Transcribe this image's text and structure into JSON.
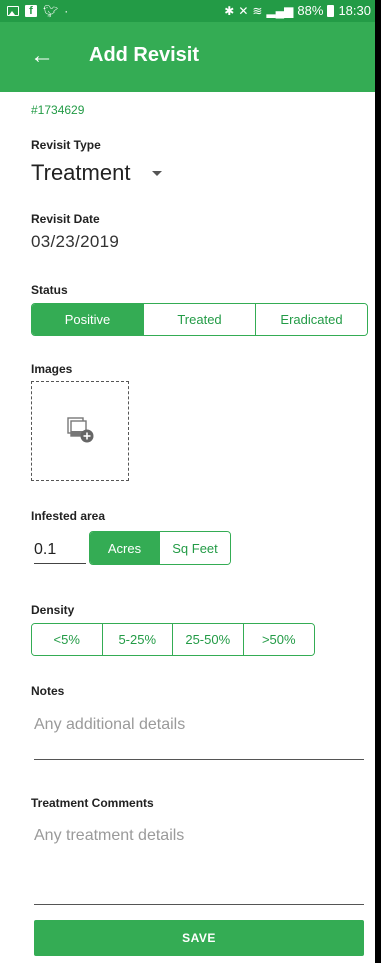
{
  "status_bar": {
    "battery": "88%",
    "time": "18:30"
  },
  "app_bar": {
    "title": "Add Revisit"
  },
  "record_id": "#1734629",
  "revisit_type": {
    "label": "Revisit Type",
    "value": "Treatment"
  },
  "revisit_date": {
    "label": "Revisit Date",
    "value": "03/23/2019"
  },
  "status": {
    "label": "Status",
    "options": [
      "Positive",
      "Treated",
      "Eradicated"
    ],
    "selected": "Positive"
  },
  "images": {
    "label": "Images",
    "icon": "add-image-icon"
  },
  "infested_area": {
    "label": "Infested area",
    "value": "0.1",
    "units": [
      "Acres",
      "Sq Feet"
    ],
    "selected_unit": "Acres"
  },
  "density": {
    "label": "Density",
    "options": [
      "<5%",
      "5-25%",
      "25-50%",
      ">50%"
    ]
  },
  "notes": {
    "label": "Notes",
    "placeholder": "Any additional details"
  },
  "treatment_comments": {
    "label": "Treatment Comments",
    "placeholder": "Any treatment details"
  },
  "save_label": "SAVE",
  "colors": {
    "primary": "#34ac54",
    "status_bar": "#239b46"
  }
}
